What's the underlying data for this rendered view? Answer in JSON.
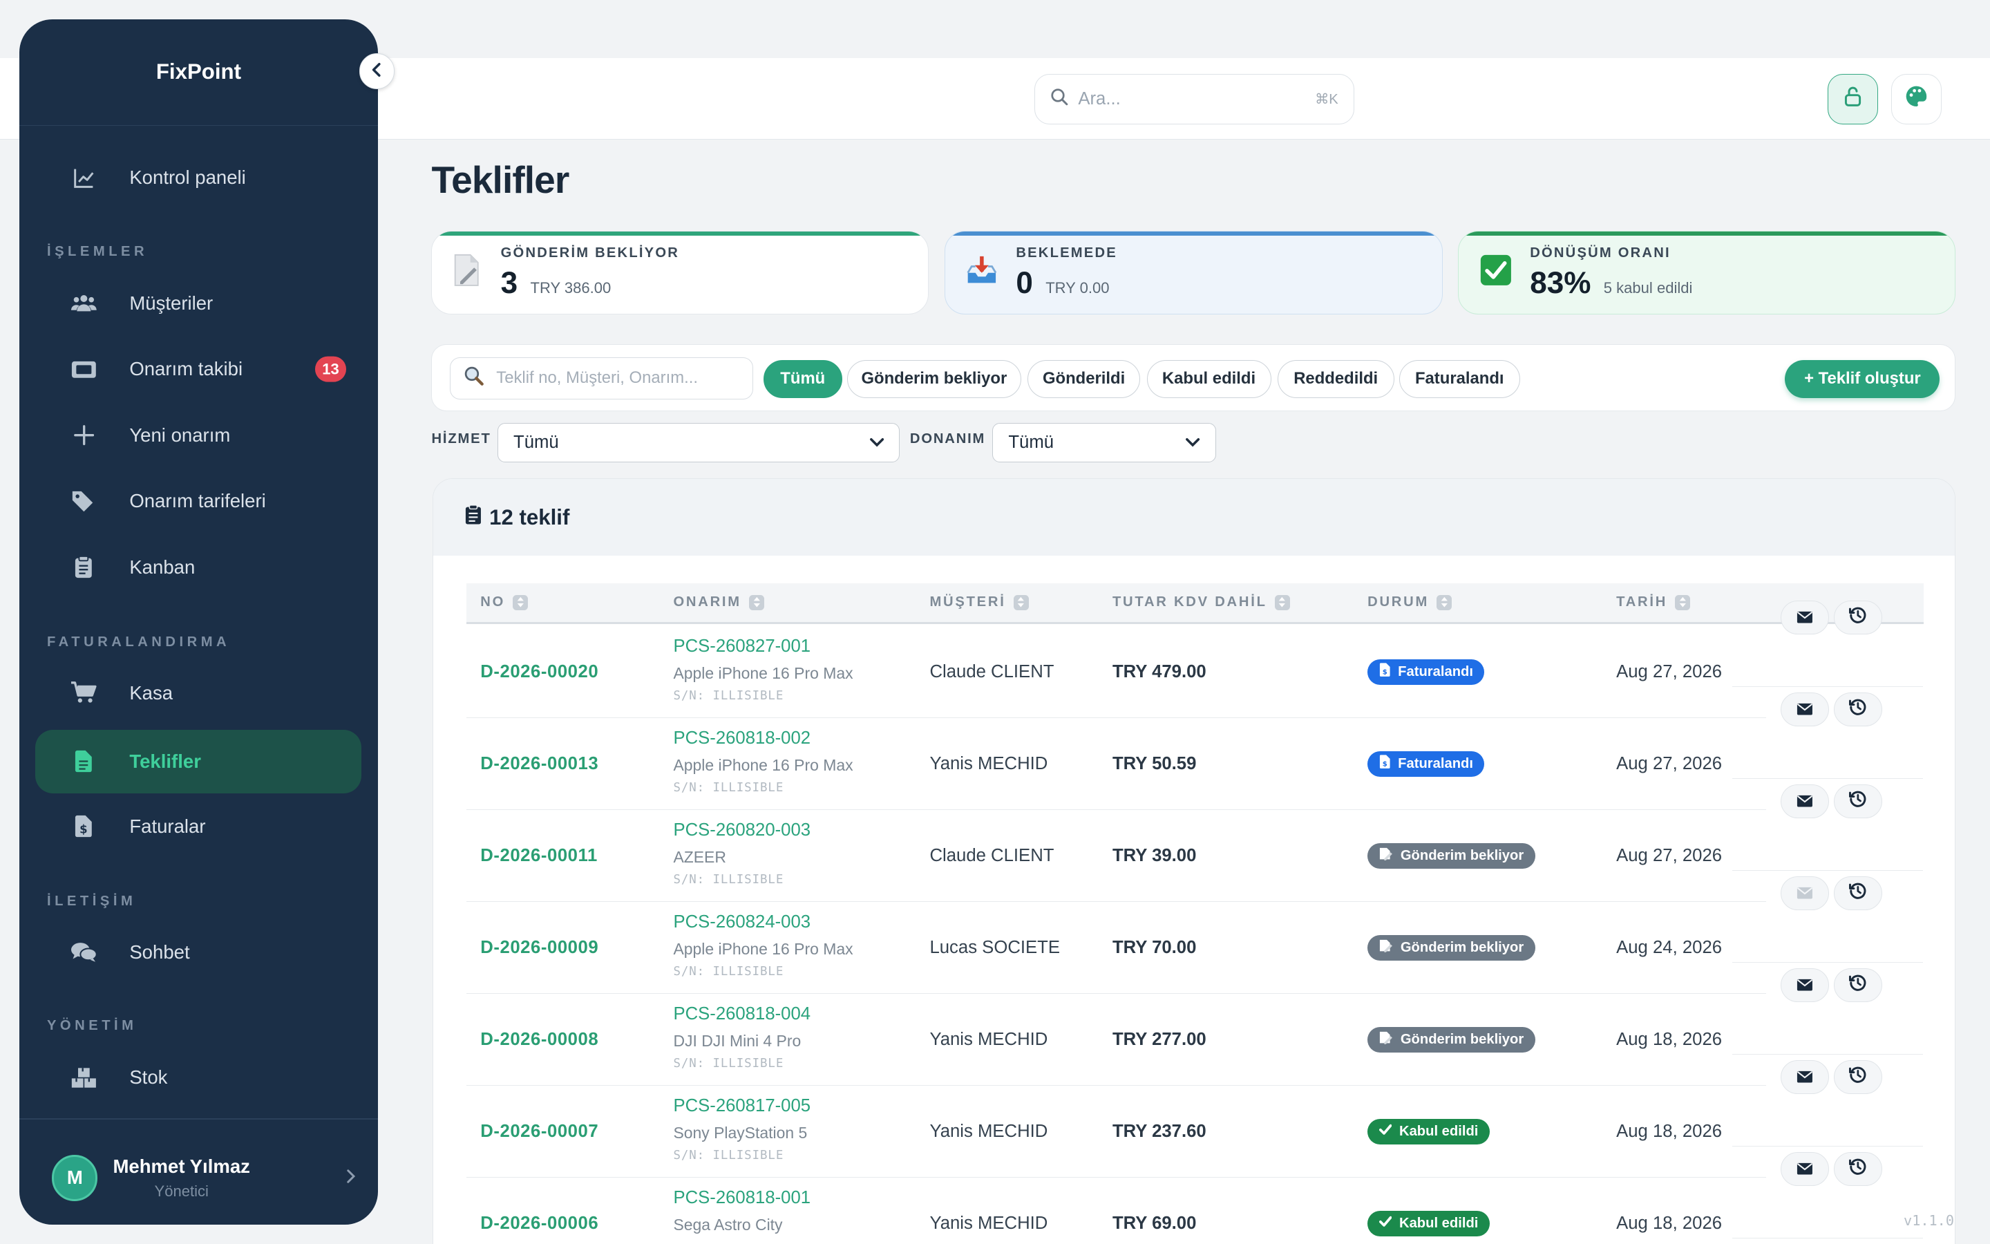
{
  "app": {
    "name": "FixPoint",
    "version": "v1.1.0"
  },
  "search": {
    "placeholder": "Ara...",
    "shortcut": "⌘K"
  },
  "sidebar": {
    "sections": {
      "islemler": "İŞLEMLER",
      "faturalandirma": "FATURALANDIRMA",
      "iletisim": "İLETİŞİM",
      "yonetim": "YÖNETİM"
    },
    "items": [
      {
        "label": "Kontrol paneli",
        "icon": "chart-line-icon"
      },
      {
        "label": "Müşteriler",
        "icon": "users-icon"
      },
      {
        "label": "Onarım takibi",
        "icon": "ticket-icon",
        "badge": "13"
      },
      {
        "label": "Yeni onarım",
        "icon": "plus-icon"
      },
      {
        "label": "Onarım tarifeleri",
        "icon": "tags-icon"
      },
      {
        "label": "Kanban",
        "icon": "clipboard-icon"
      },
      {
        "label": "Kasa",
        "icon": "cart-icon"
      },
      {
        "label": "Teklifler",
        "icon": "file-icon",
        "active": true
      },
      {
        "label": "Faturalar",
        "icon": "invoice-icon"
      },
      {
        "label": "Sohbet",
        "icon": "chat-icon"
      },
      {
        "label": "Stok",
        "icon": "boxes-icon"
      }
    ],
    "user": {
      "initial": "M",
      "name": "Mehmet Yılmaz",
      "role": "Yönetici"
    }
  },
  "page": {
    "title": "Teklifler"
  },
  "stats": [
    {
      "label": "GÖNDERİM BEKLİYOR",
      "value": "3",
      "sub": "TRY 386.00",
      "icon": "draft-file-icon",
      "accent": "#2fa57b"
    },
    {
      "label": "BEKLEMEDE",
      "value": "0",
      "sub": "TRY 0.00",
      "icon": "inbox-tray-icon",
      "accent": "#4a8fd0"
    },
    {
      "label": "DÖNÜŞÜM ORANI",
      "value": "83%",
      "sub": "5 kabul edildi",
      "icon": "check-box-icon",
      "accent": "#2b9a5b"
    }
  ],
  "filters": {
    "search_placeholder": "Teklif no, Müşteri, Onarım...",
    "chips": [
      "Tümü",
      "Gönderim bekliyor",
      "Gönderildi",
      "Kabul edildi",
      "Reddedildi",
      "Faturalandı"
    ],
    "active_chip": "Tümü",
    "create_label": "+ Teklif oluştur",
    "hizmet_label": "HİZMET",
    "hizmet_value": "Tümü",
    "donanim_label": "DONANIM",
    "donanim_value": "Tümü"
  },
  "table": {
    "count_label": "12 teklif",
    "columns": [
      "NO",
      "ONARIM",
      "MÜŞTERİ",
      "TUTAR KDV DAHİL",
      "DURUM",
      "TARİH"
    ],
    "rows": [
      {
        "no": "D-2026-00020",
        "repair": "PCS-260827-001",
        "device": "Apple iPhone 16 Pro Max",
        "sn": "S/N: ILLISIBLE",
        "customer": "Claude CLIENT",
        "amount": "TRY 479.00",
        "status": "Faturalandı",
        "status_kind": "blue",
        "date": "Aug 27, 2026",
        "mail_enabled": true
      },
      {
        "no": "D-2026-00013",
        "repair": "PCS-260818-002",
        "device": "Apple iPhone 16 Pro Max",
        "sn": "S/N: ILLISIBLE",
        "customer": "Yanis MECHID",
        "amount": "TRY 50.59",
        "status": "Faturalandı",
        "status_kind": "blue",
        "date": "Aug 27, 2026",
        "mail_enabled": true
      },
      {
        "no": "D-2026-00011",
        "repair": "PCS-260820-003",
        "device": "AZEER",
        "sn": "S/N: ILLISIBLE",
        "customer": "Claude CLIENT",
        "amount": "TRY 39.00",
        "status": "Gönderim bekliyor",
        "status_kind": "gray",
        "date": "Aug 27, 2026",
        "mail_enabled": true
      },
      {
        "no": "D-2026-00009",
        "repair": "PCS-260824-003",
        "device": "Apple iPhone 16 Pro Max",
        "sn": "S/N: ILLISIBLE",
        "customer": "Lucas SOCIETE",
        "amount": "TRY 70.00",
        "status": "Gönderim bekliyor",
        "status_kind": "gray",
        "date": "Aug 24, 2026",
        "mail_enabled": false
      },
      {
        "no": "D-2026-00008",
        "repair": "PCS-260818-004",
        "device": "DJI DJI Mini 4 Pro",
        "sn": "S/N: ILLISIBLE",
        "customer": "Yanis MECHID",
        "amount": "TRY 277.00",
        "status": "Gönderim bekliyor",
        "status_kind": "gray",
        "date": "Aug 18, 2026",
        "mail_enabled": true
      },
      {
        "no": "D-2026-00007",
        "repair": "PCS-260817-005",
        "device": "Sony PlayStation 5",
        "sn": "S/N: ILLISIBLE",
        "customer": "Yanis MECHID",
        "amount": "TRY 237.60",
        "status": "Kabul edildi",
        "status_kind": "green",
        "date": "Aug 18, 2026",
        "mail_enabled": true
      },
      {
        "no": "D-2026-00006",
        "repair": "PCS-260818-001",
        "device": "Sega Astro City",
        "sn": "",
        "customer": "Yanis MECHID",
        "amount": "TRY 69.00",
        "status": "Kabul edildi",
        "status_kind": "green",
        "date": "Aug 18, 2026",
        "mail_enabled": true
      }
    ]
  }
}
